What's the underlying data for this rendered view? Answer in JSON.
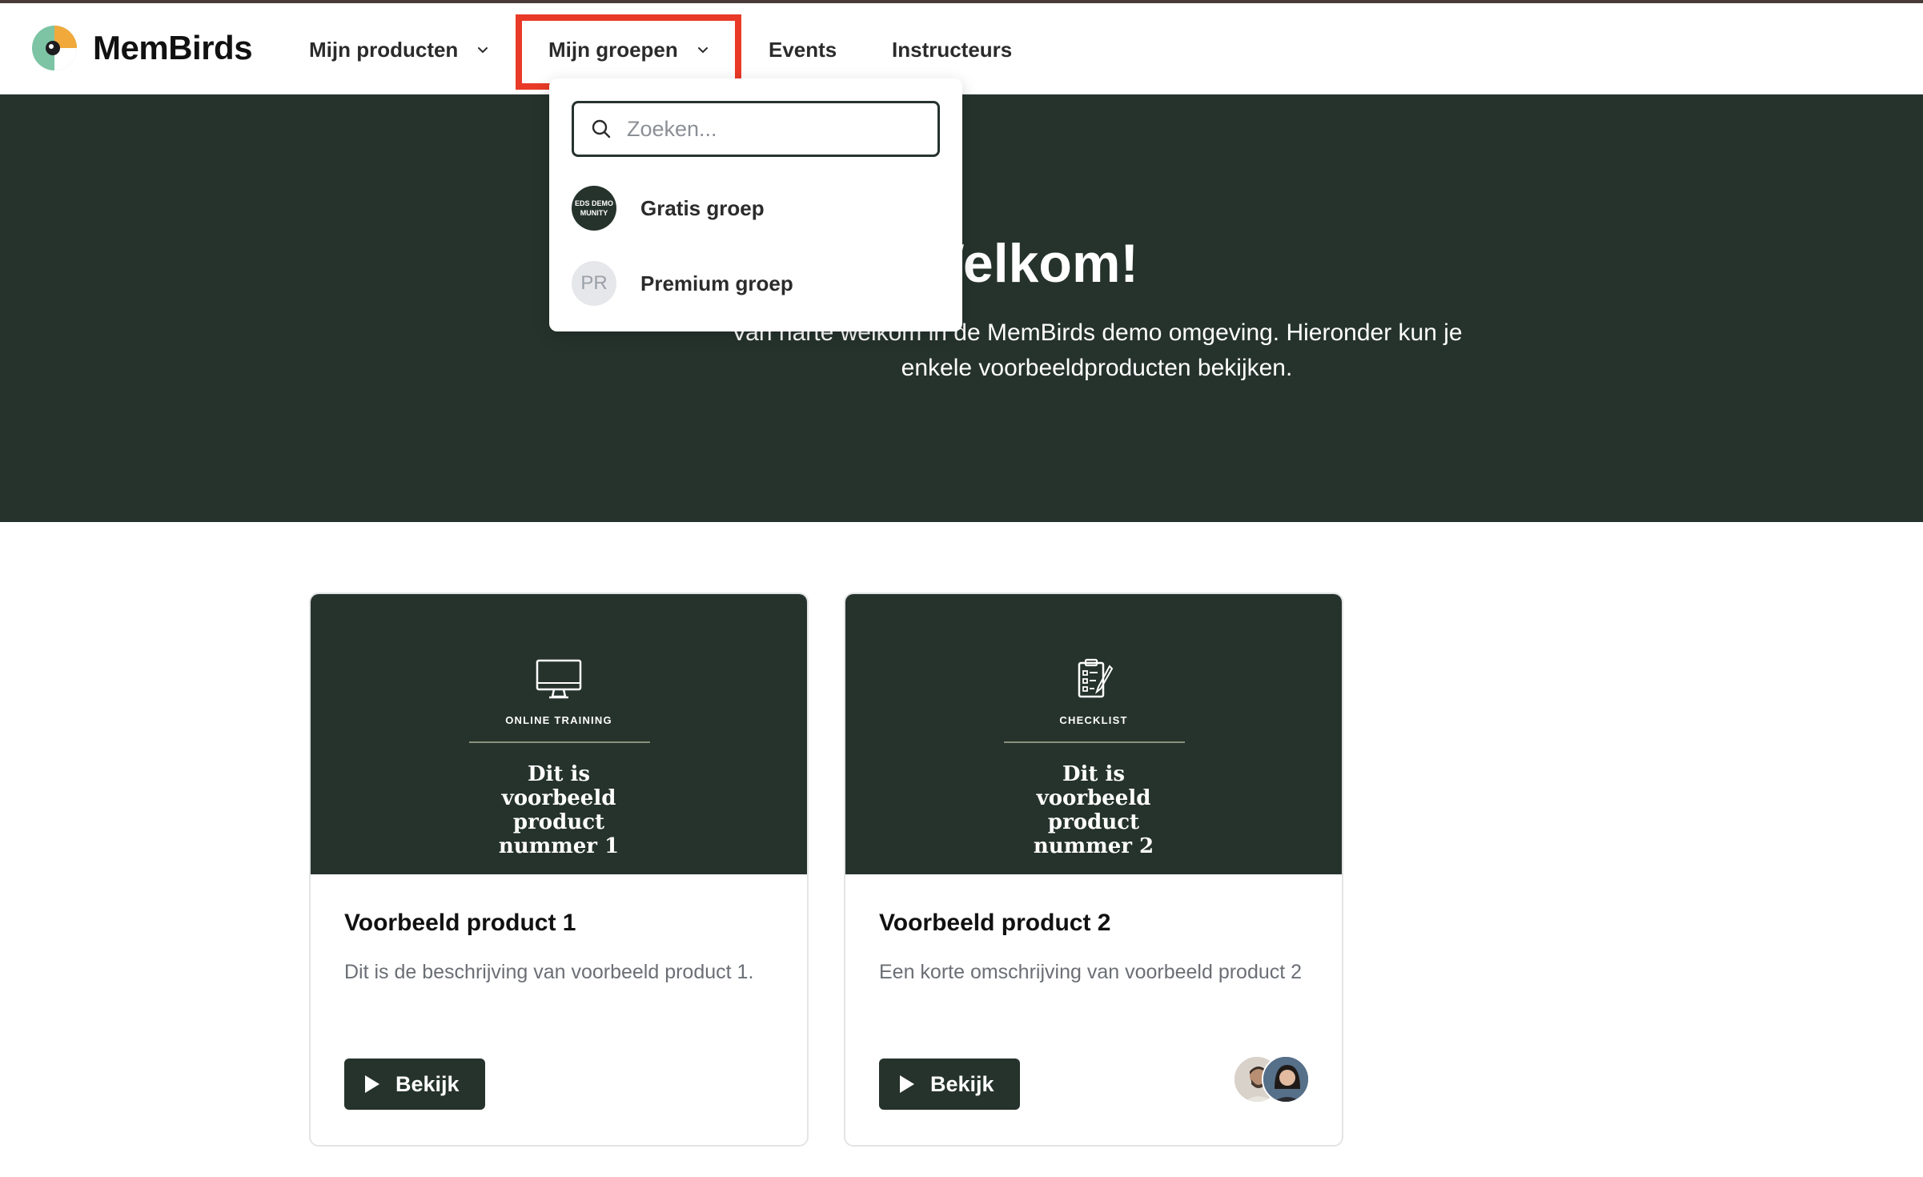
{
  "nav": {
    "brand": "MemBirds",
    "items": [
      {
        "label": "Mijn producten"
      },
      {
        "label": "Mijn groepen"
      },
      {
        "label": "Events"
      },
      {
        "label": "Instructeurs"
      }
    ]
  },
  "dropdown": {
    "search_placeholder": "Zoeken...",
    "groups": [
      {
        "label": "Gratis groep",
        "avatar_text": "EDS DEMO MUNITY"
      },
      {
        "label": "Premium groep",
        "avatar_text": "PR"
      }
    ]
  },
  "hero": {
    "title": "Welkom!",
    "subtitle": "Van harte welkom in de MemBirds demo omgeving. Hieronder kun je enkele voorbeeldproducten bekijken."
  },
  "products": [
    {
      "category": "ONLINE TRAINING",
      "image_title": "Dit is voorbeeld product nummer 1",
      "icon": "monitor-icon",
      "title": "Voorbeeld product 1",
      "description": "Dit is de beschrijving van voorbeeld product 1.",
      "button_label": "Bekijk"
    },
    {
      "category": "CHECKLIST",
      "image_title": "Dit is voorbeeld product nummer 2",
      "icon": "checklist-icon",
      "title": "Voorbeeld product 2",
      "description": "Een korte omschrijving van voorbeeld product 2",
      "button_label": "Bekijk"
    }
  ],
  "colors": {
    "primary": "#26332d",
    "highlight": "#e83a27"
  }
}
